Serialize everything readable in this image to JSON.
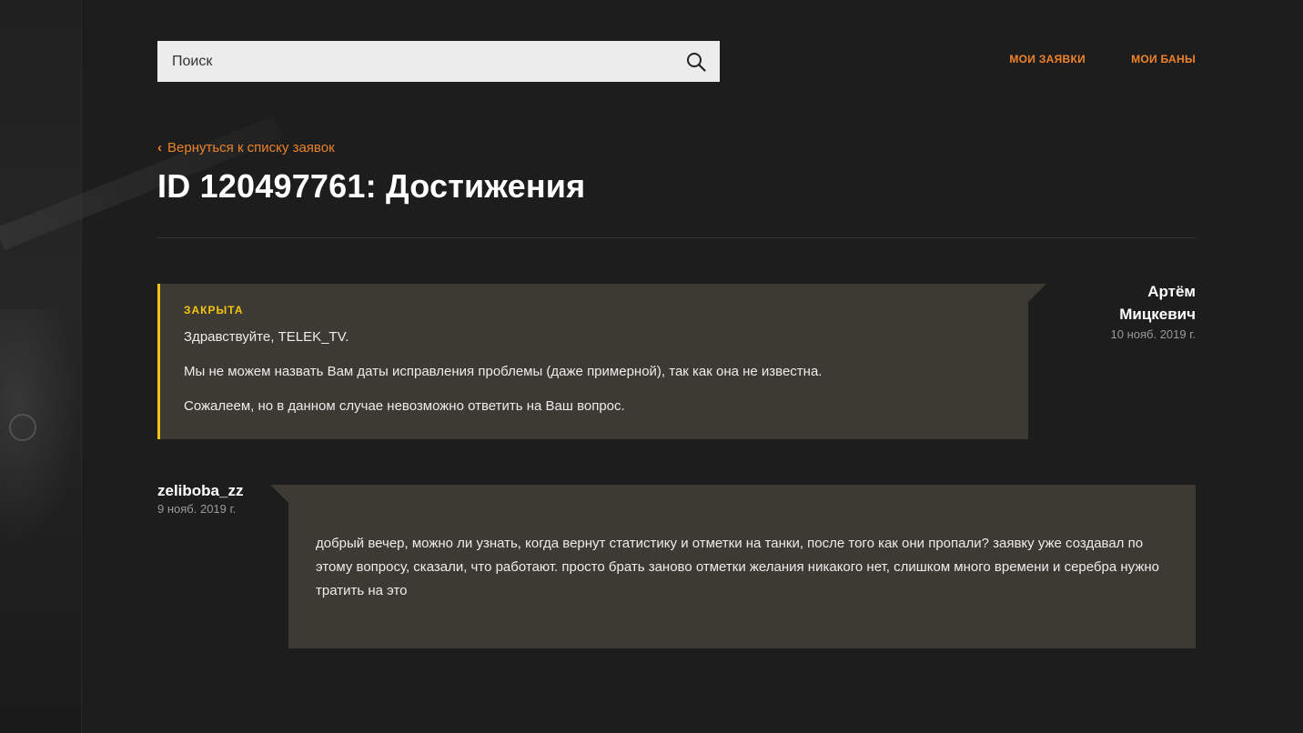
{
  "search": {
    "placeholder": "Поиск"
  },
  "nav": {
    "my_tickets": "МОИ ЗАЯВКИ",
    "my_bans": "МОИ БАНЫ"
  },
  "back_link": "Вернуться к списку заявок",
  "page_title": "ID 120497761: Достижения",
  "messages": [
    {
      "author_first": "Артём",
      "author_last": "Мицкевич",
      "date": "10 нояб. 2019 г.",
      "status": "ЗАКРЫТА",
      "lines": [
        "Здравствуйте, TELEK_TV.",
        "Мы не можем назвать Вам даты исправления проблемы (даже примерной), так как она не известна.",
        "Сожалеем, но в данном случае невозможно ответить на Ваш вопрос."
      ]
    },
    {
      "author": "zeliboba_zz",
      "date": "9 нояб. 2019 г.",
      "text": "добрый вечер, можно ли узнать, когда вернут статистику и отметки на танки, после того как они пропали? заявку уже создавал по этому вопросу, сказали, что работают. просто брать заново отметки желания никакого нет, слишком много времени и серебра нужно тратить на это"
    }
  ],
  "colors": {
    "accent_orange": "#f0832a",
    "status_yellow": "#f2c40f",
    "message_bg": "#3d3a33",
    "page_bg": "#1d1d1d"
  }
}
